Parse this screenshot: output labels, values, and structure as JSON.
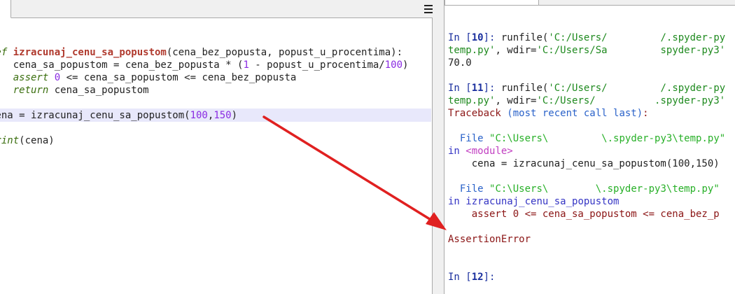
{
  "editor": {
    "lines": [
      {
        "parts": [
          {
            "t": "def ",
            "c": "kw"
          },
          {
            "t": "izracunaj_cenu_sa_popustom",
            "c": "fn"
          },
          {
            "t": "(cena_bez_popusta, popust_u_procentima):",
            "c": "pl"
          }
        ]
      },
      {
        "parts": [
          {
            "t": "    cena_sa_popustom = cena_bez_popusta * (",
            "c": "pl"
          },
          {
            "t": "1",
            "c": "num"
          },
          {
            "t": " - popust_u_procentima/",
            "c": "pl"
          },
          {
            "t": "100",
            "c": "num"
          },
          {
            "t": ")",
            "c": "pl"
          }
        ]
      },
      {
        "parts": [
          {
            "t": "    assert ",
            "c": "kwb"
          },
          {
            "t": "0",
            "c": "num"
          },
          {
            "t": " <= cena_sa_popustom <= cena_bez_popusta",
            "c": "pl"
          }
        ]
      },
      {
        "parts": [
          {
            "t": "    return ",
            "c": "kwb"
          },
          {
            "t": "cena_sa_popustom",
            "c": "pl"
          }
        ]
      },
      {
        "parts": [
          {
            "t": "cena = izracunaj_cenu_sa_popustom(",
            "c": "pl"
          },
          {
            "t": "100",
            "c": "num"
          },
          {
            "t": ",",
            "c": "pl"
          },
          {
            "t": "150",
            "c": "num"
          },
          {
            "t": ")",
            "c": "pl"
          }
        ]
      },
      {
        "parts": [
          {
            "t": "print",
            "c": "kw"
          },
          {
            "t": "(cena)",
            "c": "pl"
          }
        ]
      }
    ]
  },
  "console": {
    "lines": [
      {
        "parts": [
          {
            "t": "In [",
            "c": "prompt"
          },
          {
            "t": "10",
            "c": "pnum"
          },
          {
            "t": "]: ",
            "c": "prompt"
          },
          {
            "t": "runfile(",
            "c": "pl"
          },
          {
            "t": "'C:/Users/",
            "c": "str"
          },
          {
            "t": "         ",
            "c": "redact"
          },
          {
            "t": "/.spyder-py",
            "c": "str"
          }
        ]
      },
      {
        "parts": [
          {
            "t": "temp.py'",
            "c": "str"
          },
          {
            "t": ", wdir=",
            "c": "pl"
          },
          {
            "t": "'C:/Users/Sa",
            "c": "str"
          },
          {
            "t": "         ",
            "c": "redact"
          },
          {
            "t": "spyder-py3'",
            "c": "str"
          }
        ]
      },
      {
        "parts": [
          {
            "t": "70.0",
            "c": "pl"
          }
        ]
      },
      {
        "parts": [
          {
            "t": "In [",
            "c": "prompt"
          },
          {
            "t": "11",
            "c": "pnum"
          },
          {
            "t": "]: ",
            "c": "prompt"
          },
          {
            "t": "runfile(",
            "c": "pl"
          },
          {
            "t": "'C:/Users/",
            "c": "str"
          },
          {
            "t": "         ",
            "c": "redact"
          },
          {
            "t": "/.spyder-py",
            "c": "str"
          }
        ]
      },
      {
        "parts": [
          {
            "t": "temp.py'",
            "c": "str"
          },
          {
            "t": ", wdir=",
            "c": "pl"
          },
          {
            "t": "'C:/Users/",
            "c": "str"
          },
          {
            "t": "          ",
            "c": "redact"
          },
          {
            "t": ".spyder-py3'",
            "c": "str"
          }
        ]
      },
      {
        "parts": [
          {
            "t": "Traceback ",
            "c": "red"
          },
          {
            "t": "(most recent call last)",
            "c": "blue"
          },
          {
            "t": ":",
            "c": "red"
          }
        ]
      },
      {
        "parts": [
          {
            "t": "  File ",
            "c": "blue"
          },
          {
            "t": "\"C:\\Users\\",
            "c": "green"
          },
          {
            "t": "         ",
            "c": "redact"
          },
          {
            "t": "\\.spyder-py3\\temp.py\"",
            "c": "green"
          }
        ]
      },
      {
        "parts": [
          {
            "t": "in ",
            "c": "dblue"
          },
          {
            "t": "<module>",
            "c": "mag"
          }
        ]
      },
      {
        "parts": [
          {
            "t": "    cena = izracunaj_cenu_sa_popustom(100,150)",
            "c": "pl"
          }
        ]
      },
      {
        "parts": [
          {
            "t": "  File ",
            "c": "blue"
          },
          {
            "t": "\"C:\\Users\\",
            "c": "green"
          },
          {
            "t": "        ",
            "c": "redact"
          },
          {
            "t": "\\.spyder-py3\\temp.py\"",
            "c": "green"
          }
        ]
      },
      {
        "parts": [
          {
            "t": "in ",
            "c": "dblue"
          },
          {
            "t": "izracunaj_cenu_sa_popustom",
            "c": "dblue"
          }
        ]
      },
      {
        "parts": [
          {
            "t": "    assert 0 <= cena_sa_popustom <= cena_bez_p",
            "c": "red"
          }
        ]
      },
      {
        "parts": [
          {
            "t": "AssertionError",
            "c": "red"
          }
        ]
      },
      {
        "parts": [
          {
            "t": "In [",
            "c": "prompt"
          },
          {
            "t": "12",
            "c": "pnum"
          },
          {
            "t": "]: ",
            "c": "prompt"
          }
        ]
      }
    ]
  }
}
